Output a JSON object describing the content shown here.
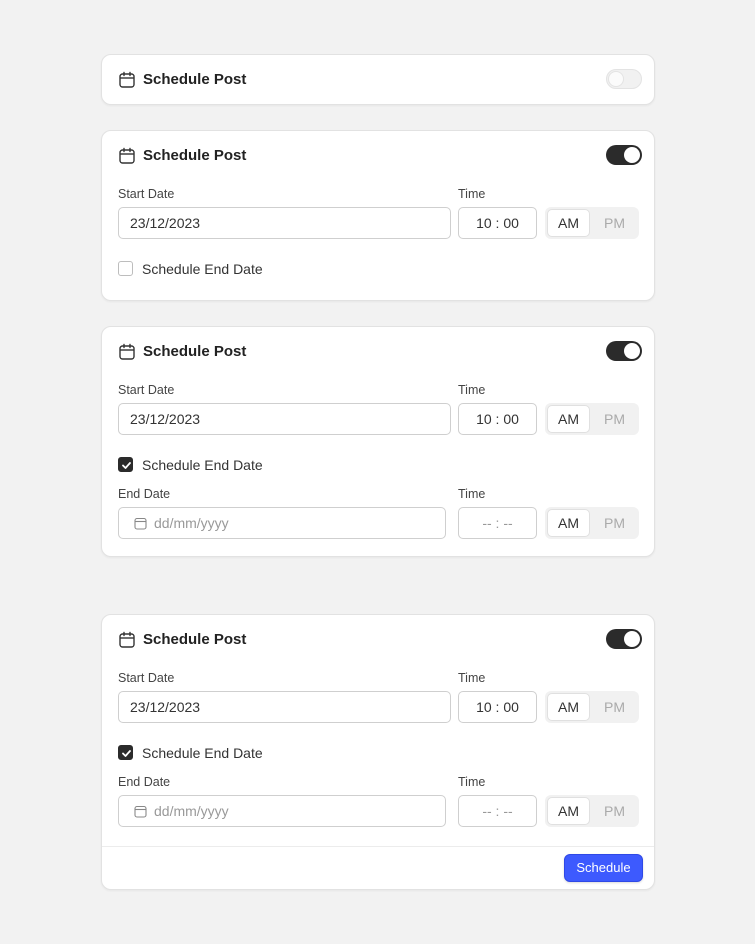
{
  "colors": {
    "background": "#f2f2f2",
    "toggle_on": "#2b2b2b",
    "accent": "#3d5afe"
  },
  "icons": {
    "calendar": "calendar-icon",
    "date_field": "calendar-icon",
    "check": "check-icon"
  },
  "card1": {
    "title": "Schedule Post",
    "toggle_on": false
  },
  "card2": {
    "title": "Schedule Post",
    "toggle_on": true,
    "start_date_label": "Start Date",
    "start_date_value": "23/12/2023",
    "start_time_label": "Time",
    "start_time_value": "10 : 00",
    "am": "AM",
    "pm": "PM",
    "selected_period": "AM",
    "end_date_checkbox_label": "Schedule End Date",
    "end_date_checked": false
  },
  "card3": {
    "title": "Schedule Post",
    "toggle_on": true,
    "start_date_label": "Start Date",
    "start_date_value": "23/12/2023",
    "start_time_label": "Time",
    "start_time_value": "10 : 00",
    "am": "AM",
    "pm": "PM",
    "end_date_checkbox_label": "Schedule End Date",
    "end_date_checked": true,
    "end_date_label": "End Date",
    "end_date_placeholder": "dd/mm/yyyy",
    "end_time_label": "Time",
    "end_time_placeholder": "-- : --",
    "end_am": "AM",
    "end_pm": "PM"
  },
  "card4": {
    "title": "Schedule Post",
    "toggle_on": true,
    "start_date_label": "Start Date",
    "start_date_value": "23/12/2023",
    "start_time_label": "Time",
    "start_time_value": "10 : 00",
    "am": "AM",
    "pm": "PM",
    "end_date_checkbox_label": "Schedule End Date",
    "end_date_checked": true,
    "end_date_label": "End Date",
    "end_date_placeholder": "dd/mm/yyyy",
    "end_time_label": "Time",
    "end_time_placeholder": "-- : --",
    "end_am": "AM",
    "end_pm": "PM",
    "schedule_button": "Schedule"
  }
}
